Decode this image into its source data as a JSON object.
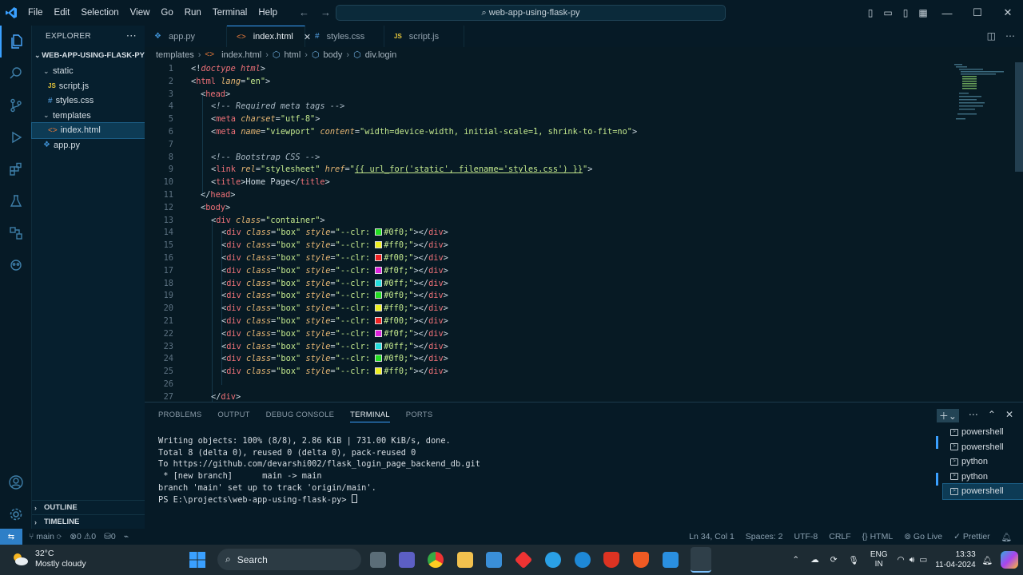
{
  "menu": [
    "File",
    "Edit",
    "Selection",
    "View",
    "Go",
    "Run",
    "Terminal",
    "Help"
  ],
  "command_center": "web-app-using-flask-py",
  "explorer": {
    "title": "EXPLORER",
    "root": "WEB-APP-USING-FLASK-PY",
    "items": [
      {
        "label": "static",
        "type": "folder"
      },
      {
        "label": "script.js",
        "type": "js"
      },
      {
        "label": "styles.css",
        "type": "css"
      },
      {
        "label": "templates",
        "type": "folder"
      },
      {
        "label": "index.html",
        "type": "html"
      },
      {
        "label": "app.py",
        "type": "py"
      }
    ],
    "outline": "OUTLINE",
    "timeline": "TIMELINE"
  },
  "tabs": [
    {
      "label": "app.py",
      "icon": "py"
    },
    {
      "label": "index.html",
      "icon": "html"
    },
    {
      "label": "styles.css",
      "icon": "css"
    },
    {
      "label": "script.js",
      "icon": "js"
    }
  ],
  "breadcrumb": [
    "templates",
    "index.html",
    "html",
    "body",
    "div.login"
  ],
  "code_lines": [
    "1",
    "2",
    "3",
    "4",
    "5",
    "6",
    "7",
    "8",
    "9",
    "10",
    "11",
    "12",
    "13",
    "14",
    "15",
    "16",
    "17",
    "18",
    "19",
    "20",
    "21",
    "22",
    "23",
    "24",
    "25",
    "26",
    "27"
  ],
  "code": {
    "l1a": "<!",
    "l1b": "doctype html",
    "l1c": ">",
    "l2": "<html lang=\"en\">",
    "l3": "<head>",
    "l4": "<!-- Required meta tags -->",
    "l5": "<meta charset=\"utf-8\">",
    "l6": "<meta name=\"viewport\" content=\"width=device-width, initial-scale=1, shrink-to-fit=no\">",
    "l8": "<!-- Bootstrap CSS -->",
    "l9": "<link rel=\"stylesheet\" href=\"{{ url_for('static', filename='styles.css') }}\">",
    "l10": "<title>Home Page</title>",
    "l11": "</head>",
    "l12": "<body>",
    "l13": "<div class=\"container\">",
    "l27": "</div>",
    "box_colors": [
      "#0f0",
      "#ff0",
      "#f00",
      "#f0f",
      "#0ff",
      "#0f0",
      "#ff0",
      "#f00",
      "#f0f",
      "#0ff",
      "#0f0",
      "#ff0"
    ],
    "box_swatches": [
      "#22dd22",
      "#eeee22",
      "#ee2222",
      "#dd22dd",
      "#22dddd",
      "#22dd22",
      "#eeee22",
      "#ee2222",
      "#dd22dd",
      "#22dddd",
      "#22dd22",
      "#eeee22"
    ]
  },
  "panel": {
    "tabs": [
      "PROBLEMS",
      "OUTPUT",
      "DEBUG CONSOLE",
      "TERMINAL",
      "PORTS"
    ],
    "terminal_lines": [
      "Writing objects: 100% (8/8), 2.86 KiB | 731.00 KiB/s, done.",
      "Total 8 (delta 0), reused 0 (delta 0), pack-reused 0",
      "To https://github.com/devarshi002/flask_login_page_backend_db.git",
      " * [new branch]      main -> main",
      "branch 'main' set up to track 'origin/main'.",
      "PS E:\\projects\\web-app-using-flask-py> "
    ],
    "terminals": [
      "powershell",
      "powershell",
      "python",
      "python",
      "powershell"
    ]
  },
  "status": {
    "branch": "main",
    "errors": "0",
    "warnings": "0",
    "ports": "0",
    "position": "Ln 34, Col 1",
    "spaces": "Spaces: 2",
    "encoding": "UTF-8",
    "eol": "CRLF",
    "language": "HTML",
    "golive": "Go Live",
    "prettier": "Prettier"
  },
  "taskbar": {
    "temp": "32°C",
    "weather": "Mostly cloudy",
    "search": "Search",
    "lang1": "ENG",
    "lang2": "IN",
    "time": "13:33",
    "date": "11-04-2024"
  },
  "colors": {
    "accent": "#3aa0ff",
    "bg": "#061a26",
    "editor": "#071a24"
  }
}
